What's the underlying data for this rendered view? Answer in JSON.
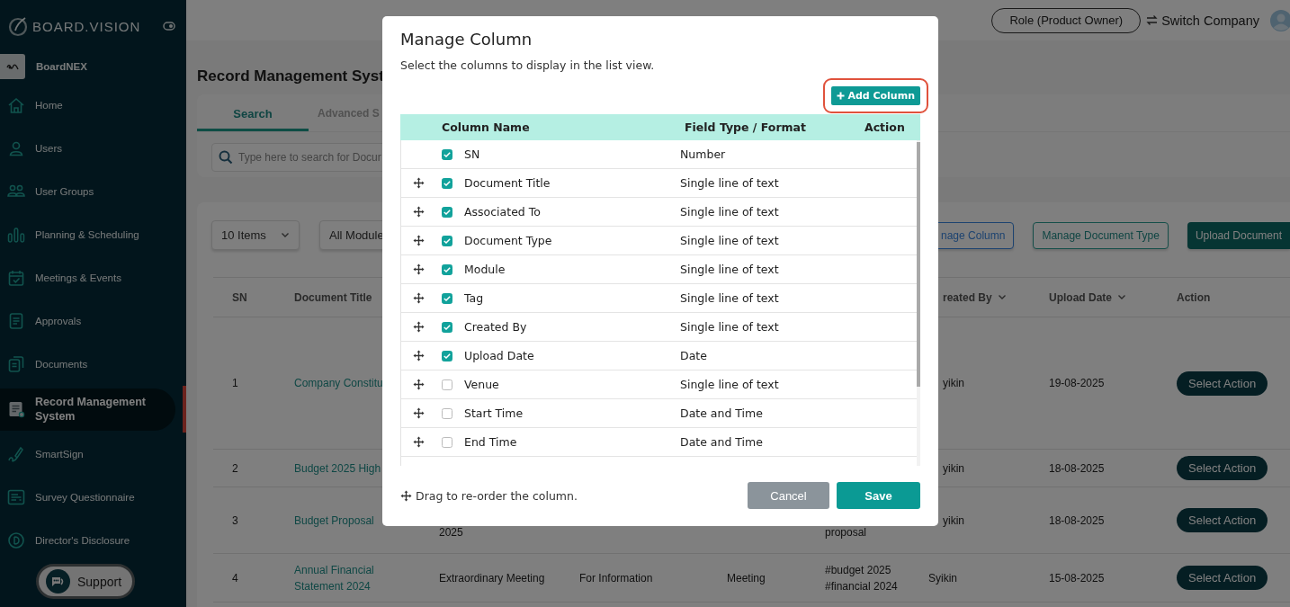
{
  "brand": {
    "logo": "BOARD.VISION",
    "workspace": "BoardNEX"
  },
  "sidebar": {
    "items": [
      {
        "label": "Home",
        "selected": false
      },
      {
        "label": "Users",
        "selected": false
      },
      {
        "label": "User Groups",
        "selected": false
      },
      {
        "label": "Planning & Scheduling",
        "selected": false
      },
      {
        "label": "Meetings & Events",
        "selected": false
      },
      {
        "label": "Approvals",
        "selected": false
      },
      {
        "label": "Documents",
        "selected": false
      },
      {
        "label": "Record Management System",
        "selected": true
      },
      {
        "label": "SmartSign",
        "selected": false
      },
      {
        "label": "Survey Questionnaire",
        "selected": false
      },
      {
        "label": "Director's Disclosure",
        "selected": false
      }
    ],
    "support": "Support"
  },
  "header": {
    "role": "Role (Product Owner)",
    "switch_company": "Switch Company"
  },
  "page": {
    "title": "Record Management Syst",
    "tabs": [
      {
        "label": "Search",
        "selected": true
      },
      {
        "label": "Advanced S",
        "selected": false
      }
    ],
    "search": {
      "placeholder": "Type here to search for Docur"
    },
    "page_size": "10 Items",
    "module_filter": "All Module",
    "buttons": [
      {
        "label": "nage Column",
        "kind": "outline-blue"
      },
      {
        "label": "Manage Document Type",
        "kind": "outline"
      },
      {
        "label": "Upload Document",
        "kind": "filled"
      }
    ],
    "table": {
      "header": {
        "sn": {
          "label": "SN",
          "sortable": false
        },
        "document_title": {
          "label": "Document Title",
          "sortable": false
        },
        "created_by": {
          "label": "reated By",
          "sortable": true
        },
        "upload_date": {
          "label": "Upload Date",
          "sortable": true
        },
        "action": {
          "label": "Action",
          "sortable": false
        }
      },
      "rows": [
        {
          "sn": "1",
          "document_title": "Company Constitu",
          "created_by": "yikin",
          "upload_date": "19-08-2025",
          "action": "Select Action"
        },
        {
          "sn": "2",
          "document_title": "Budget 2025 High",
          "created_by": "yikin",
          "upload_date": "18-08-2025",
          "action": "Select Action"
        },
        {
          "sn": "3",
          "document_title": "Budget Proposal",
          "associated_to": "2025",
          "tag": [
            "proposal"
          ],
          "created_by": "yikin",
          "upload_date": "18-08-2025",
          "action": "Select Action"
        },
        {
          "sn": "4",
          "document_title": "Annual Financial Statement 2024",
          "associated_to": "Extraordinary Meeting",
          "document_type": "For Information",
          "module": "Meeting",
          "tag": [
            "#budget 2025",
            "#financial 2024"
          ],
          "created_by": "Syikin",
          "upload_date": "15-08-2025",
          "action": "Select Action"
        }
      ]
    }
  },
  "modal": {
    "title": "Manage Column",
    "subtitle": "Select the columns to display in the list view.",
    "add_button": "Add Column",
    "columns": [
      "Column Name",
      "Field Type / Format",
      "Action"
    ],
    "rows": [
      {
        "name": "SN",
        "type": "Number",
        "checked": true,
        "draggable": false
      },
      {
        "name": "Document Title",
        "type": "Single line of text",
        "checked": true,
        "draggable": true
      },
      {
        "name": "Associated To",
        "type": "Single line of text",
        "checked": true,
        "draggable": true
      },
      {
        "name": "Document Type",
        "type": "Single line of text",
        "checked": true,
        "draggable": true
      },
      {
        "name": "Module",
        "type": "Single line of text",
        "checked": true,
        "draggable": true
      },
      {
        "name": "Tag",
        "type": "Single line of text",
        "checked": true,
        "draggable": true
      },
      {
        "name": "Created By",
        "type": "Single line of text",
        "checked": true,
        "draggable": true
      },
      {
        "name": "Upload Date",
        "type": "Date",
        "checked": true,
        "draggable": true
      },
      {
        "name": "Venue",
        "type": "Single line of text",
        "checked": false,
        "draggable": true
      },
      {
        "name": "Start Time",
        "type": "Date and Time",
        "checked": false,
        "draggable": true
      },
      {
        "name": "End Time",
        "type": "Date and Time",
        "checked": false,
        "draggable": true
      }
    ],
    "hint": "Drag to re-order the column.",
    "cancel": "Cancel",
    "save": "Save"
  }
}
